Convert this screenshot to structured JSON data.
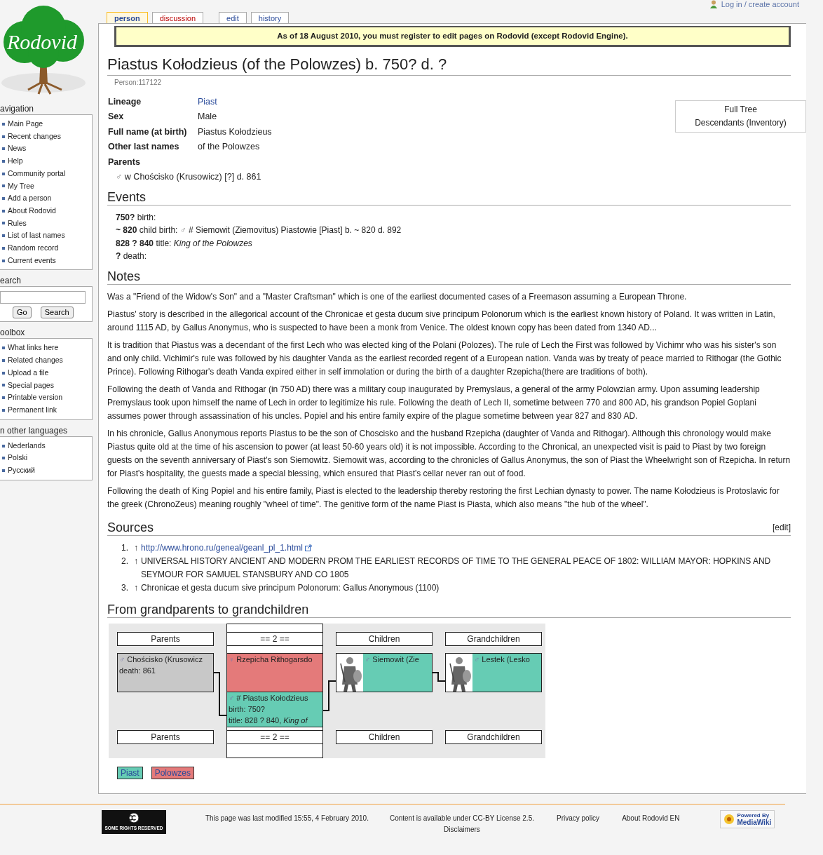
{
  "logo": {
    "text": "Rodovid"
  },
  "personal_link": {
    "label": "Log in / create account"
  },
  "tabs": [
    {
      "label": "person",
      "selected": true,
      "missing": false
    },
    {
      "label": "discussion",
      "selected": false,
      "missing": true
    },
    {
      "label": "edit",
      "selected": false,
      "missing": false
    },
    {
      "label": "history",
      "selected": false,
      "missing": false
    }
  ],
  "sidebar": [
    {
      "kind": "links",
      "title": "avigation",
      "items": [
        "Main Page",
        "Recent changes",
        "News",
        "Help",
        "Community portal",
        "My Tree",
        "Add a person",
        "About Rodovid",
        "Rules",
        "List of last names",
        "Random record",
        "Current events"
      ]
    },
    {
      "kind": "search",
      "title": "earch",
      "buttons": [
        "Go",
        "Search"
      ]
    },
    {
      "kind": "links",
      "title": "oolbox",
      "items": [
        "What links here",
        "Related changes",
        "Upload a file",
        "Special pages",
        "Printable version",
        "Permanent link"
      ]
    },
    {
      "kind": "links",
      "title": "n other languages",
      "items": [
        "Nederlands",
        "Polski",
        "Русский"
      ]
    }
  ],
  "notice": "As of 18 August 2010, you must register to edit pages on Rodovid (except Rodovid Engine).",
  "title": "Piastus Kołodzieus (of the Polowzes) b. 750? d. ?",
  "subtitle": "Person:117122",
  "facts": [
    {
      "label": "Lineage",
      "value": "Piast",
      "link": true
    },
    {
      "label": "Sex",
      "value": "Male",
      "link": false
    },
    {
      "label": "Full name (at birth)",
      "value": "Piastus Kołodzieus",
      "link": false
    },
    {
      "label": "Other last names",
      "value": "of the Polowzes",
      "link": false
    }
  ],
  "parents": {
    "label": "Parents",
    "items": [
      {
        "sign": "♂",
        "name": "w Chościsko (Krusowicz)",
        "lineage": "[?]",
        "detail": "d. 861"
      }
    ]
  },
  "tree_links": [
    "Full Tree",
    "Descendants (Inventory)"
  ],
  "events": {
    "heading": "Events",
    "items": [
      {
        "date": "750?",
        "type": "birth:"
      },
      {
        "date": "~ 820",
        "type": "child birth:",
        "sign": "♂",
        "person": "# Siemowit (Ziemovitus) Piastowie",
        "lineage": "[Piast]",
        "detail": "b. ~ 820 d. 892"
      },
      {
        "date": "828 ? 840",
        "type": "title:",
        "title": "King of the Polowzes"
      },
      {
        "date": "?",
        "type": "death:"
      }
    ]
  },
  "notes": {
    "heading": "Notes",
    "paragraphs": [
      "Was a \"Friend of the Widow's Son\" and a \"Master Craftsman\" which is one of the earliest documented cases of a Freemason assuming a European Throne.",
      "Piastus' story is described in the allegorical account of the Chronicae et gesta ducum sive principum Polonorum which is the earliest known history of Poland. It was written in Latin, around 1115 AD, by Gallus Anonymus, who is suspected to have been a monk from Venice. The oldest known copy has been dated from 1340 AD...",
      "It is tradition that Piastus was a decendant of the first Lech who was elected king of the Polani (Polozes). The rule of Lech the First was followed by Vichimr who was his sister's son and only child. Vichimir's rule was followed by his daughter Vanda as the earliest recorded regent of a European nation. Vanda was by treaty of peace married to Rithogar (the Gothic Prince). Following Rithogar's death Vanda expired either in self immolation or during the birth of a daughter Rzepicha(there are traditions of both).",
      "Following the death of Vanda and Rithogar (in 750 AD) there was a military coup inaugurated by Premyslaus, a general of the army Polowzian army. Upon assuming leadership Premyslaus took upon himself the name of Lech in order to legitimize his rule. Following the death of Lech II, sometime between 770 and 800 AD, his grandson Popiel Goplani assumes power through assassination of his uncles. Popiel and his entire family expire of the plague sometime between year 827 and 830 AD.",
      "In his chronicle, Gallus Anonymous reports Piastus to be the son of Choscisko and the husband Rzepicha (daughter of Vanda and Rithogar). Although this chronology would make Piastus quite old at the time of his ascension to power (at least 50-60 years old) it is not impossible. According to the Chronical, an unexpected visit is paid to Piast by two foreign guests on the seventh anniversary of Piast's son Siemowitz. Siemowit was, according to the chronicles of Gallus Anonymus, the son of Piast the Wheelwright son of Rzepicha. In return for Piast's hospitality, the guests made a special blessing, which ensured that Piast's cellar never ran out of food.",
      "Following the death of King Popiel and his entire family, Piast is elected to the leadership thereby restoring the first Lechian dynasty to power. The name Kołodzieus is Protoslavic for the greek (ChronoZeus) meaning roughly \"wheel of time\". The genitive form of the name Piast is Piasta, which also means \"the hub of the wheel\"."
    ]
  },
  "sources": {
    "heading": "Sources",
    "edit": "[edit]",
    "items": [
      {
        "number": "1.",
        "arrow": "↑",
        "text": "http://www.hrono.ru/geneal/geanl_pl_1.html",
        "link": true
      },
      {
        "number": "2.",
        "arrow": "↑",
        "text": "UNIVERSAL HISTORY ANCIENT AND MODERN PROM THE EARLIEST RECORDS OF TIME TO THE GENERAL PEACE OF 1802: WILLIAM MAYOR: HOPKINS AND SEYMOUR FOR SAMUEL STANSBURY AND CO 1805",
        "link": false
      },
      {
        "number": "3.",
        "arrow": "↑",
        "text": "Chronicae et gesta ducum sive principum Polonorum: Gallus Anonymous (1100)",
        "link": false
      }
    ]
  },
  "family_tree": {
    "heading": "From grandparents to grandchildren",
    "columns": [
      {
        "header": "Parents",
        "footer": "Parents",
        "cells": [
          {
            "sign": "♂",
            "name": "Chościsko (Krusowicz",
            "lines": [
              "death: 861"
            ],
            "color": "#c8c8c8",
            "picture": false
          }
        ]
      },
      {
        "header": "== 2 ==",
        "footer": "== 2 ==",
        "cells": [
          {
            "sign": "♀",
            "name": "Rzepicha Rithogarsdo",
            "color": "#e47a7a",
            "picture": false
          },
          {
            "sign": "♂",
            "name": "# Piastus Kołodzieus",
            "lines": [
              "birth: 750?",
              "title: 828 ? 840, *King of*"
            ],
            "color": "#66ccb4",
            "picture": false
          }
        ]
      },
      {
        "header": "Children",
        "footer": "Children",
        "cells": [
          {
            "sign": "♂",
            "name": "Siemowit (Zie",
            "color": "#66ccb4",
            "picture": true
          }
        ]
      },
      {
        "header": "Grandchildren",
        "footer": "Grandchildren",
        "cells": [
          {
            "sign": "♂",
            "name": "Lestek (Lesko",
            "color": "#66ccb4",
            "picture": true
          }
        ]
      }
    ],
    "lineages": [
      {
        "label": "Piast",
        "color": "#66ccb4"
      },
      {
        "label": "Polowzes",
        "color": "#e47a7a"
      }
    ]
  },
  "footer": {
    "badge": "SOME RIGHTS RESERVED",
    "modified": "This page was last modified 15:55, 4 February 2010.",
    "license_prefix": "Content is available under",
    "license_link": "CC-BY License 2.5.",
    "links": [
      "Privacy policy",
      "About Rodovid EN"
    ],
    "disclaimers": "Disclaimers",
    "powered": [
      "Powered By",
      "MediaWiki"
    ]
  }
}
